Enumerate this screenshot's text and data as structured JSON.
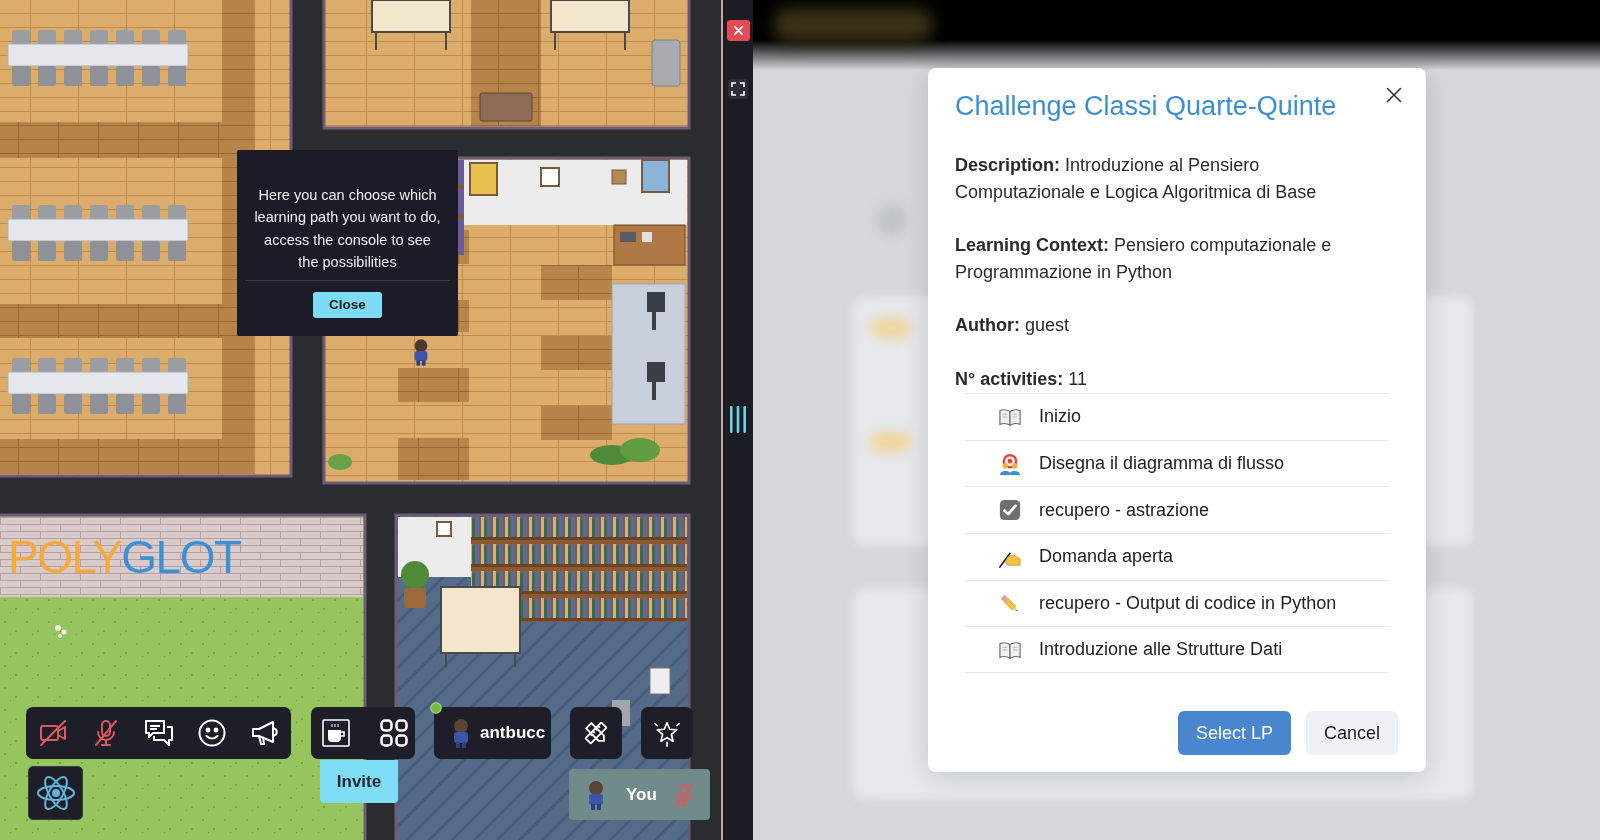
{
  "map": {
    "logo": [
      {
        "text": "POLY",
        "color": "#f5a93a"
      },
      {
        "text": "GLOT",
        "color": "#3d8fd6"
      }
    ]
  },
  "tooltip": {
    "text": "Here you can choose which learning path you want to do, access the console to see the possibilities",
    "button": "Close"
  },
  "toolbar": {
    "camera": {
      "on": false
    },
    "microphone": {
      "on": false
    },
    "user": {
      "name": "antbucc",
      "online": true
    },
    "invite": "Invite"
  },
  "self_view": {
    "label": "You",
    "microphone": {
      "on": false
    }
  },
  "modal": {
    "title": "Challenge Classi Quarte-Quinte",
    "details": [
      "**Description:** Introduzione al Pensiero Computazionale e Logica Algoritmica di Base",
      "**Learning Context:** Pensiero computazionale e Programmazione in Python",
      "**Author:** guest",
      "**N° activities:** 11"
    ],
    "activities": [
      {
        "kind": "reading",
        "title": "Inizio"
      },
      {
        "kind": "group",
        "title": "Disegna il diagramma di flusso"
      },
      {
        "kind": "quiz",
        "title": "recupero - astrazione"
      },
      {
        "kind": "open",
        "title": "Domanda aperta"
      },
      {
        "kind": "exercise",
        "title": "recupero - Output di codice in Python"
      },
      {
        "kind": "reading",
        "title": "Introduzione alle Strutture Dati"
      }
    ],
    "buttons": [
      {
        "kind": "primary",
        "label": "Select LP"
      },
      {
        "kind": "secondary",
        "label": "Cancel"
      }
    ]
  }
}
